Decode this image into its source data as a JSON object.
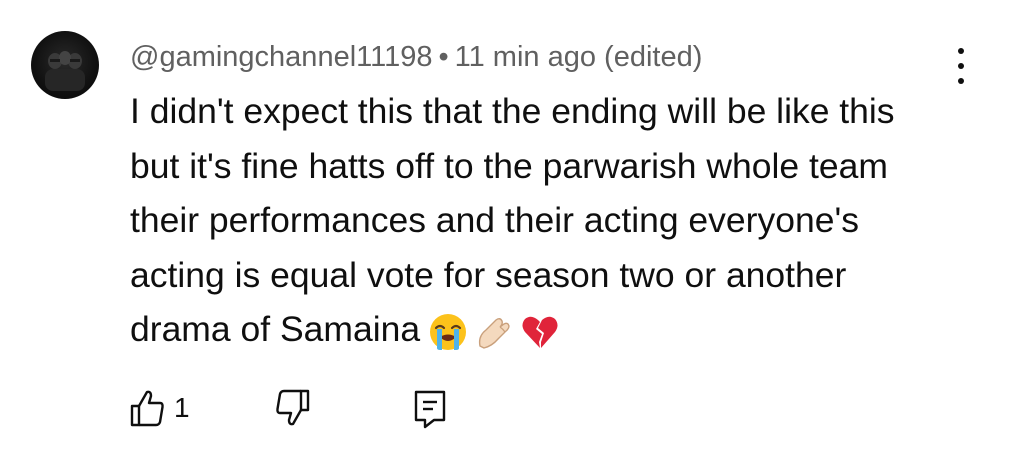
{
  "comment": {
    "author": "@gamingchannel11198",
    "separator": "•",
    "timestamp": "11 min ago (edited)",
    "text_lines": [
      "I didn't expect this that the ending will be like this",
      "but it's fine hatts off to the parwarish whole team",
      "their performances and their acting everyone's",
      "acting is equal vote for season two or another",
      "drama of Samaina"
    ],
    "emojis": [
      "loudly-crying-face",
      "pinching-hand",
      "broken-heart"
    ],
    "like_count": "1"
  },
  "icons": {
    "like": "thumbs-up-icon",
    "dislike": "thumbs-down-icon",
    "reply": "reply-icon",
    "more": "more-vertical-icon"
  },
  "colors": {
    "text_primary": "#0f0f0f",
    "text_secondary": "#606060",
    "background": "#ffffff"
  }
}
